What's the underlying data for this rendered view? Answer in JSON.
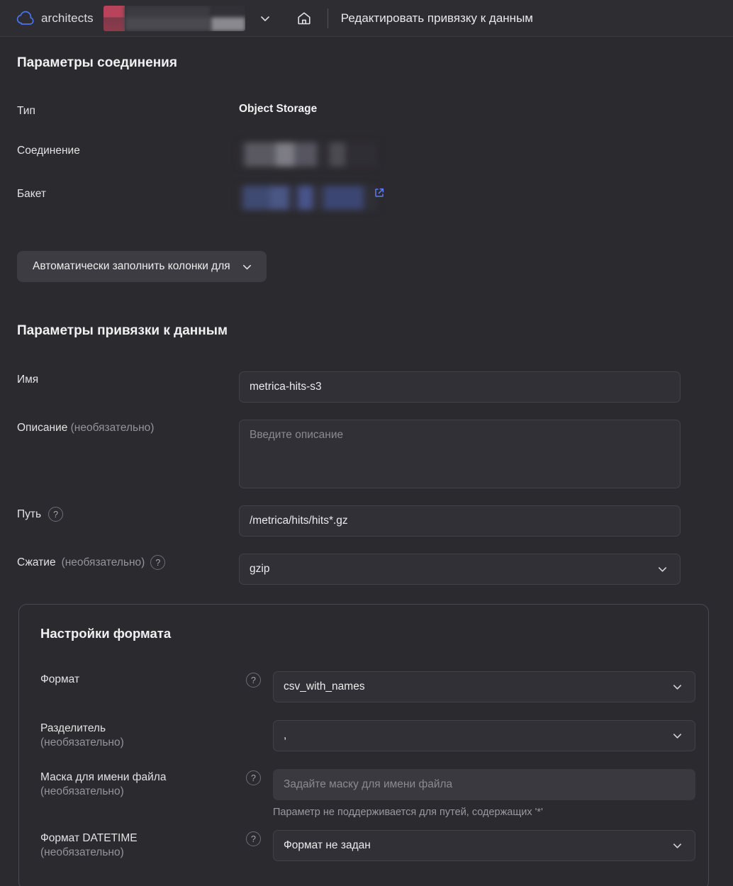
{
  "topbar": {
    "cloud_icon": "cloud-icon",
    "org_name": "architects",
    "folder_redacted": true,
    "chevron_icon": "chevron-down-icon",
    "home_icon": "home-icon",
    "page_title": "Редактировать привязку к данным"
  },
  "connection_section": {
    "title": "Параметры соединения",
    "rows": [
      {
        "label": "Тип",
        "value": "Object Storage",
        "kind": "text"
      },
      {
        "label": "Соединение",
        "value": "",
        "kind": "blurred"
      },
      {
        "label": "Бакет",
        "value": "",
        "kind": "blurred-link"
      }
    ],
    "autofill_button": {
      "label": "Автоматически заполнить колонки для",
      "chevron_icon": "chevron-down-icon"
    }
  },
  "binding_section": {
    "title": "Параметры привязки к данным",
    "name": {
      "label": "Имя",
      "value": "metrica-hits-s3"
    },
    "description": {
      "label": "Описание",
      "label_optional": "(необязательно)",
      "value": "",
      "placeholder": "Введите описание"
    },
    "path": {
      "label": "Путь",
      "help_icon": "help-icon",
      "value": "/metrica/hits/hits*.gz"
    },
    "compression": {
      "label": "Сжатие",
      "label_optional": "(необязательно)",
      "help_icon": "help-icon",
      "value": "gzip",
      "chevron_icon": "chevron-down-icon"
    }
  },
  "format_panel": {
    "title": "Настройки формата",
    "format": {
      "label": "Формат",
      "help_icon": "help-icon",
      "value": "csv_with_names",
      "chevron_icon": "chevron-down-icon"
    },
    "delimiter": {
      "label": "Разделитель",
      "label_optional": "(необязательно)",
      "value": ",",
      "chevron_icon": "chevron-down-icon"
    },
    "filename_mask": {
      "label": "Маска для имени файла",
      "label_optional": "(необязательно)",
      "help_icon": "help-icon",
      "value": "",
      "placeholder": "Задайте маску для имени файла",
      "hint": "Параметр не поддерживается для путей, содержащих '*'",
      "disabled": true
    },
    "datetime_format": {
      "label": "Формат DATETIME",
      "label_optional": "(необязательно)",
      "help_icon": "help-icon",
      "value": "Формат не задан",
      "chevron_icon": "chevron-down-icon"
    }
  },
  "colors": {
    "background": "#2b2a2e",
    "topbar_background": "#2e2d32",
    "field_background": "#303036",
    "field_border": "#42414a",
    "accent_blue": "#5b7df5",
    "text_primary": "#e8e8ea",
    "text_muted": "#95949b",
    "redaction_red": "#b8435a"
  }
}
